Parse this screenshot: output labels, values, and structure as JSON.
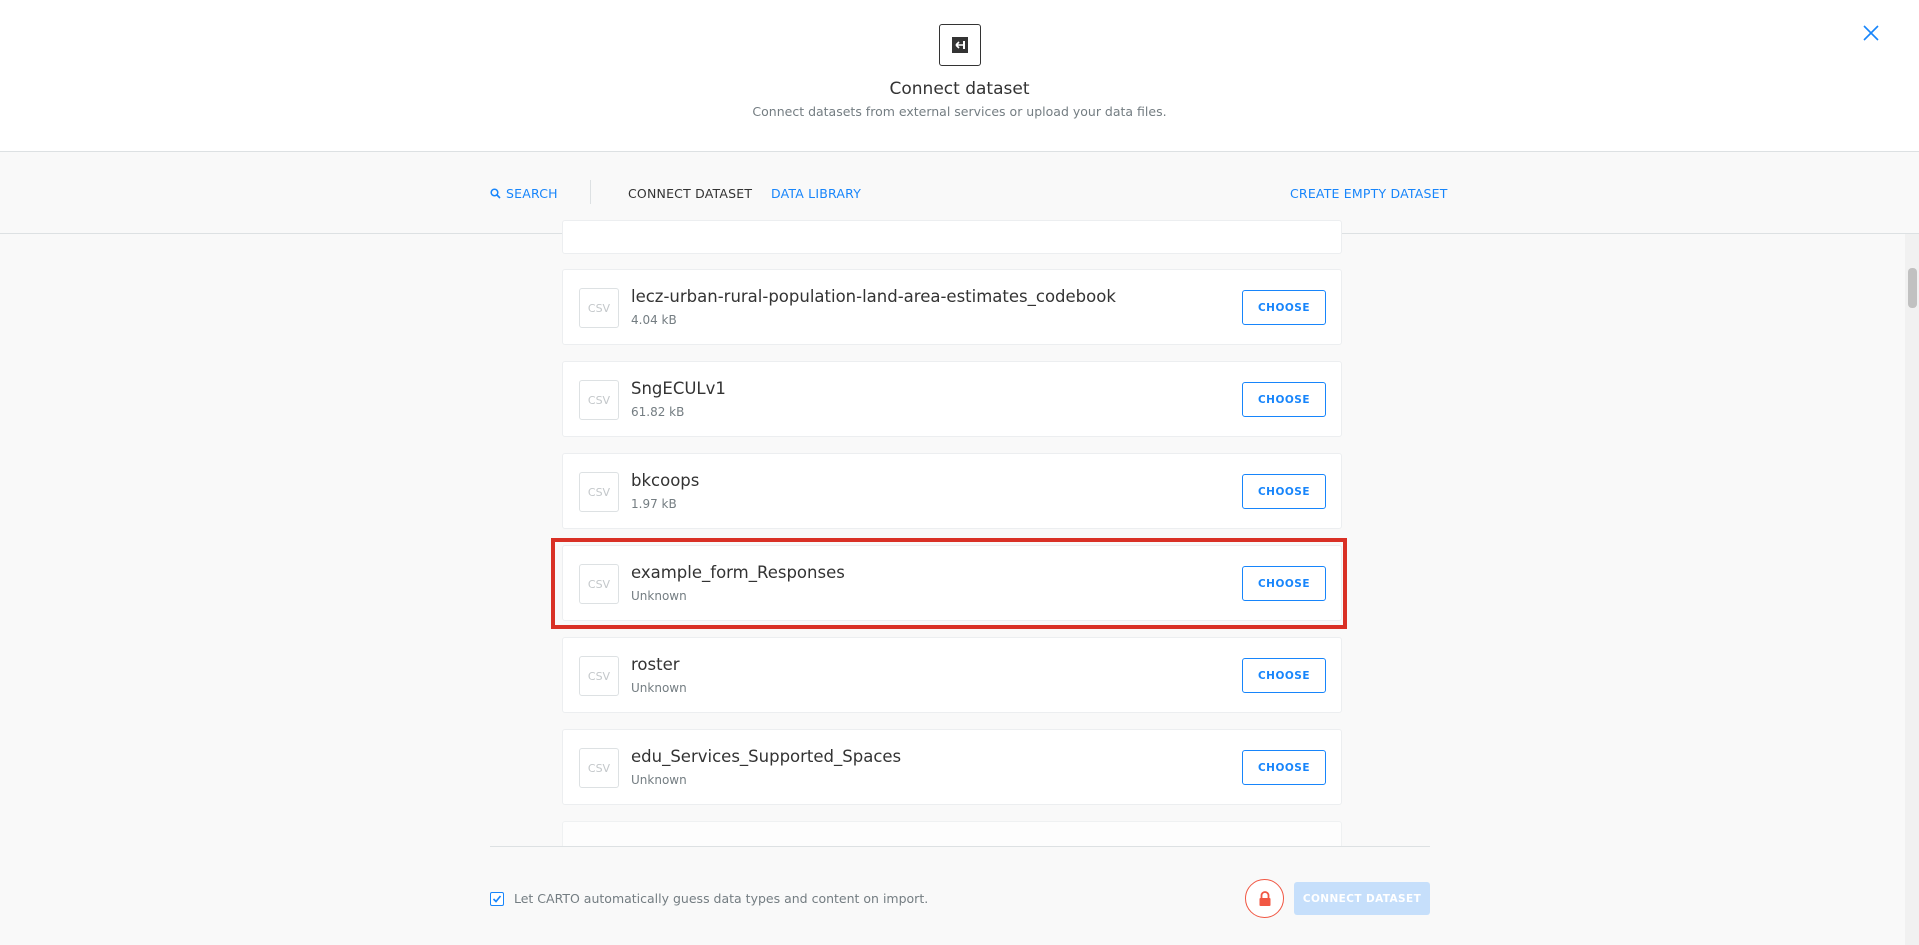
{
  "header": {
    "title": "Connect dataset",
    "subtitle": "Connect datasets from external services or upload your data files.",
    "icon": "connect-dataset-icon",
    "close_icon": "close-icon"
  },
  "tabs": {
    "search": "SEARCH",
    "connect": "CONNECT DATASET",
    "library": "DATA LIBRARY",
    "create": "CREATE EMPTY DATASET"
  },
  "datasets": [
    {
      "type": "CSV",
      "name": "lecz-urban-rural-population-land-area-estimates_codebook",
      "size": "4.04 kB",
      "action": "CHOOSE"
    },
    {
      "type": "CSV",
      "name": "SngECULv1",
      "size": "61.82 kB",
      "action": "CHOOSE"
    },
    {
      "type": "CSV",
      "name": "bkcoops",
      "size": "1.97 kB",
      "action": "CHOOSE"
    },
    {
      "type": "CSV",
      "name": "example_form_Responses",
      "size": "Unknown",
      "action": "CHOOSE"
    },
    {
      "type": "CSV",
      "name": "roster",
      "size": "Unknown",
      "action": "CHOOSE"
    },
    {
      "type": "CSV",
      "name": "edu_Services_Supported_Spaces",
      "size": "Unknown",
      "action": "CHOOSE"
    }
  ],
  "footer": {
    "guess_label": "Let CARTO automatically guess data types and content on import.",
    "guess_checked": true,
    "connect_label": "CONNECT DATASET"
  },
  "colors": {
    "accent": "#1785fb",
    "highlight": "#d93025",
    "lock": "#f15743"
  }
}
